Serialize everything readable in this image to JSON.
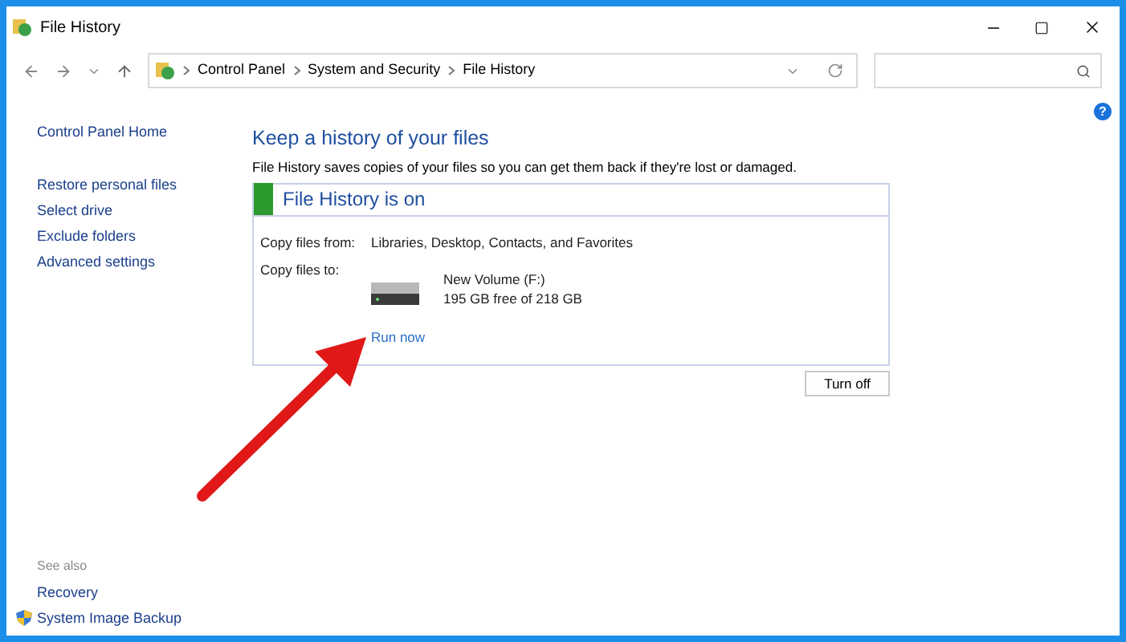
{
  "window": {
    "title": "File History"
  },
  "address_bar": {
    "crumbs": [
      "Control Panel",
      "System and Security",
      "File History"
    ]
  },
  "help": "?",
  "sidebar": {
    "items": [
      "Control Panel Home",
      "Restore personal files",
      "Select drive",
      "Exclude folders",
      "Advanced settings"
    ],
    "see_also_label": "See also",
    "see_also": [
      {
        "label": "Recovery",
        "kind": "plain"
      },
      {
        "label": "System Image Backup",
        "kind": "shield"
      }
    ]
  },
  "main": {
    "heading": "Keep a history of your files",
    "description": "File History saves copies of your files so you can get them back if they're lost or damaged.",
    "status": {
      "title": "File History is on",
      "on": true
    },
    "copy_from_label": "Copy files from:",
    "copy_from": "Libraries, Desktop, Contacts, and Favorites",
    "copy_to_label": "Copy files to:",
    "drive_name": "New Volume (F:)",
    "drive_space": "195 GB free of 218 GB",
    "run_now": "Run now",
    "turn_off": "Turn off"
  }
}
